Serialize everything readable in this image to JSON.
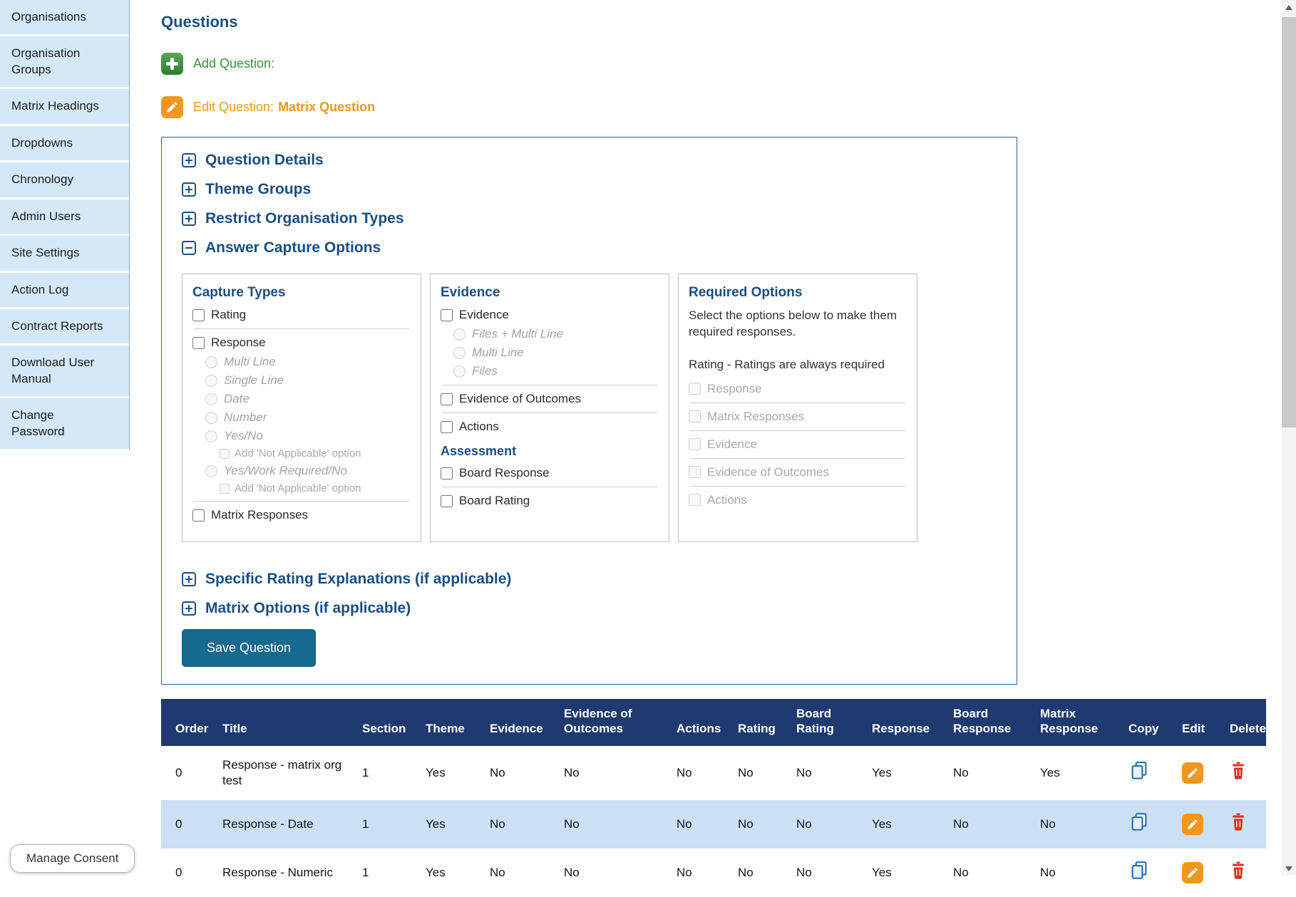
{
  "sidebar": {
    "items": [
      "Organisations",
      "Organisation\nGroups",
      "Matrix Headings",
      "Dropdowns",
      "Chronology",
      "Admin Users",
      "Site Settings",
      "Action Log",
      "Contract Reports",
      "Download User\nManual",
      "Change\nPassword"
    ]
  },
  "page": {
    "title": "Questions"
  },
  "toolbar": {
    "add_label": "Add Question:",
    "edit_label": "Edit Question:",
    "edit_question_name": "Matrix Question"
  },
  "panel": {
    "sections": {
      "question_details": "Question Details",
      "theme_groups": "Theme Groups",
      "restrict_org_types": "Restrict Organisation Types",
      "answer_capture_options": "Answer Capture Options",
      "specific_rating_explanations": "Specific Rating Explanations (if applicable)",
      "matrix_options": "Matrix Options (if applicable)"
    },
    "capture_types": {
      "title": "Capture Types",
      "rating": "Rating",
      "response": "Response",
      "response_types": [
        "Multi Line",
        "Single Line",
        "Date",
        "Number",
        "Yes/No",
        "Yes/Work Required/No"
      ],
      "not_applicable_option": "Add 'Not Applicable' option",
      "matrix_responses": "Matrix Responses"
    },
    "evidence": {
      "title": "Evidence",
      "evidence": "Evidence",
      "evidence_types": [
        "Files + Multi Line",
        "Multi Line",
        "Files"
      ],
      "evidence_of_outcomes": "Evidence of Outcomes",
      "actions": "Actions",
      "assessment_title": "Assessment",
      "board_response": "Board Response",
      "board_rating": "Board Rating"
    },
    "required_options": {
      "title": "Required Options",
      "instructions": "Select the options below to make them required responses.",
      "rating_note": "Rating - Ratings are always required",
      "options": [
        "Response",
        "Matrix Responses",
        "Evidence",
        "Evidence of Outcomes",
        "Actions"
      ]
    },
    "save_button": "Save Question"
  },
  "questions_table": {
    "headers": [
      "Order",
      "Title",
      "Section",
      "Theme",
      "Evidence",
      "Evidence of Outcomes",
      "Actions",
      "Rating",
      "Board Rating",
      "Response",
      "Board Response",
      "Matrix Response",
      "Copy",
      "Edit",
      "Delete"
    ],
    "rows": [
      [
        "0",
        "Response - matrix org test",
        "1",
        "Yes",
        "No",
        "No",
        "No",
        "No",
        "No",
        "Yes",
        "No",
        "Yes"
      ],
      [
        "0",
        "Response - Date",
        "1",
        "Yes",
        "No",
        "No",
        "No",
        "No",
        "No",
        "Yes",
        "No",
        "No"
      ],
      [
        "0",
        "Response - Numeric",
        "1",
        "Yes",
        "No",
        "No",
        "No",
        "No",
        "No",
        "Yes",
        "No",
        "No"
      ]
    ]
  },
  "footer": {
    "manage_consent": "Manage Consent"
  },
  "colors": {
    "heading_navy": "#1b4e81",
    "add_green": "#3e8f3e",
    "edit_orange": "#f0971e",
    "save_button_blue": "#17698f",
    "table_header_navy": "#1f3a70",
    "row_alt_blue": "#cce0f5",
    "delete_red": "#e02b20",
    "copy_blue": "#2e75b6",
    "sidebar_blue": "#d5e8f8"
  }
}
